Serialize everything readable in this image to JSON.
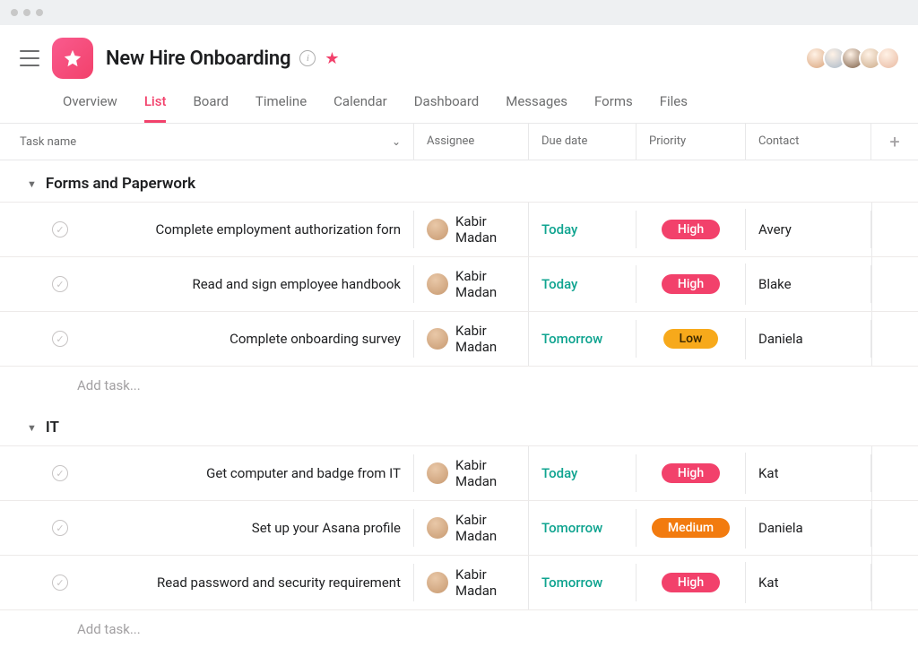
{
  "project": {
    "title": "New Hire Onboarding"
  },
  "tabs": [
    "Overview",
    "List",
    "Board",
    "Timeline",
    "Calendar",
    "Dashboard",
    "Messages",
    "Forms",
    "Files"
  ],
  "active_tab": "List",
  "columns": {
    "task": "Task name",
    "assignee": "Assignee",
    "due": "Due date",
    "priority": "Priority",
    "contact": "Contact"
  },
  "add_task_label": "Add task...",
  "avatars": [
    "#d9a37a",
    "#a8b8c8",
    "#7a5c44",
    "#caa987",
    "#e8b8a0"
  ],
  "sections": [
    {
      "name": "Forms and Paperwork",
      "tasks": [
        {
          "name": "Complete employment authorization forn",
          "assignee": "Kabir Madan",
          "due": "Today",
          "due_class": "due-today",
          "priority": "High",
          "priority_class": "pill-high",
          "contact": "Avery"
        },
        {
          "name": "Read and sign employee handbook",
          "assignee": "Kabir Madan",
          "due": "Today",
          "due_class": "due-today",
          "priority": "High",
          "priority_class": "pill-high",
          "contact": "Blake"
        },
        {
          "name": "Complete onboarding survey",
          "assignee": "Kabir Madan",
          "due": "Tomorrow",
          "due_class": "due-tomorrow",
          "priority": "Low",
          "priority_class": "pill-low",
          "contact": "Daniela"
        }
      ]
    },
    {
      "name": "IT",
      "tasks": [
        {
          "name": "Get computer and badge from IT",
          "assignee": "Kabir Madan",
          "due": "Today",
          "due_class": "due-today",
          "priority": "High",
          "priority_class": "pill-high",
          "contact": "Kat"
        },
        {
          "name": "Set up your Asana profile",
          "assignee": "Kabir Madan",
          "due": "Tomorrow",
          "due_class": "due-tomorrow",
          "priority": "Medium",
          "priority_class": "pill-medium",
          "contact": "Daniela"
        },
        {
          "name": "Read password and security requirement",
          "assignee": "Kabir Madan",
          "due": "Tomorrow",
          "due_class": "due-tomorrow",
          "priority": "High",
          "priority_class": "pill-high",
          "contact": "Kat"
        }
      ]
    }
  ]
}
